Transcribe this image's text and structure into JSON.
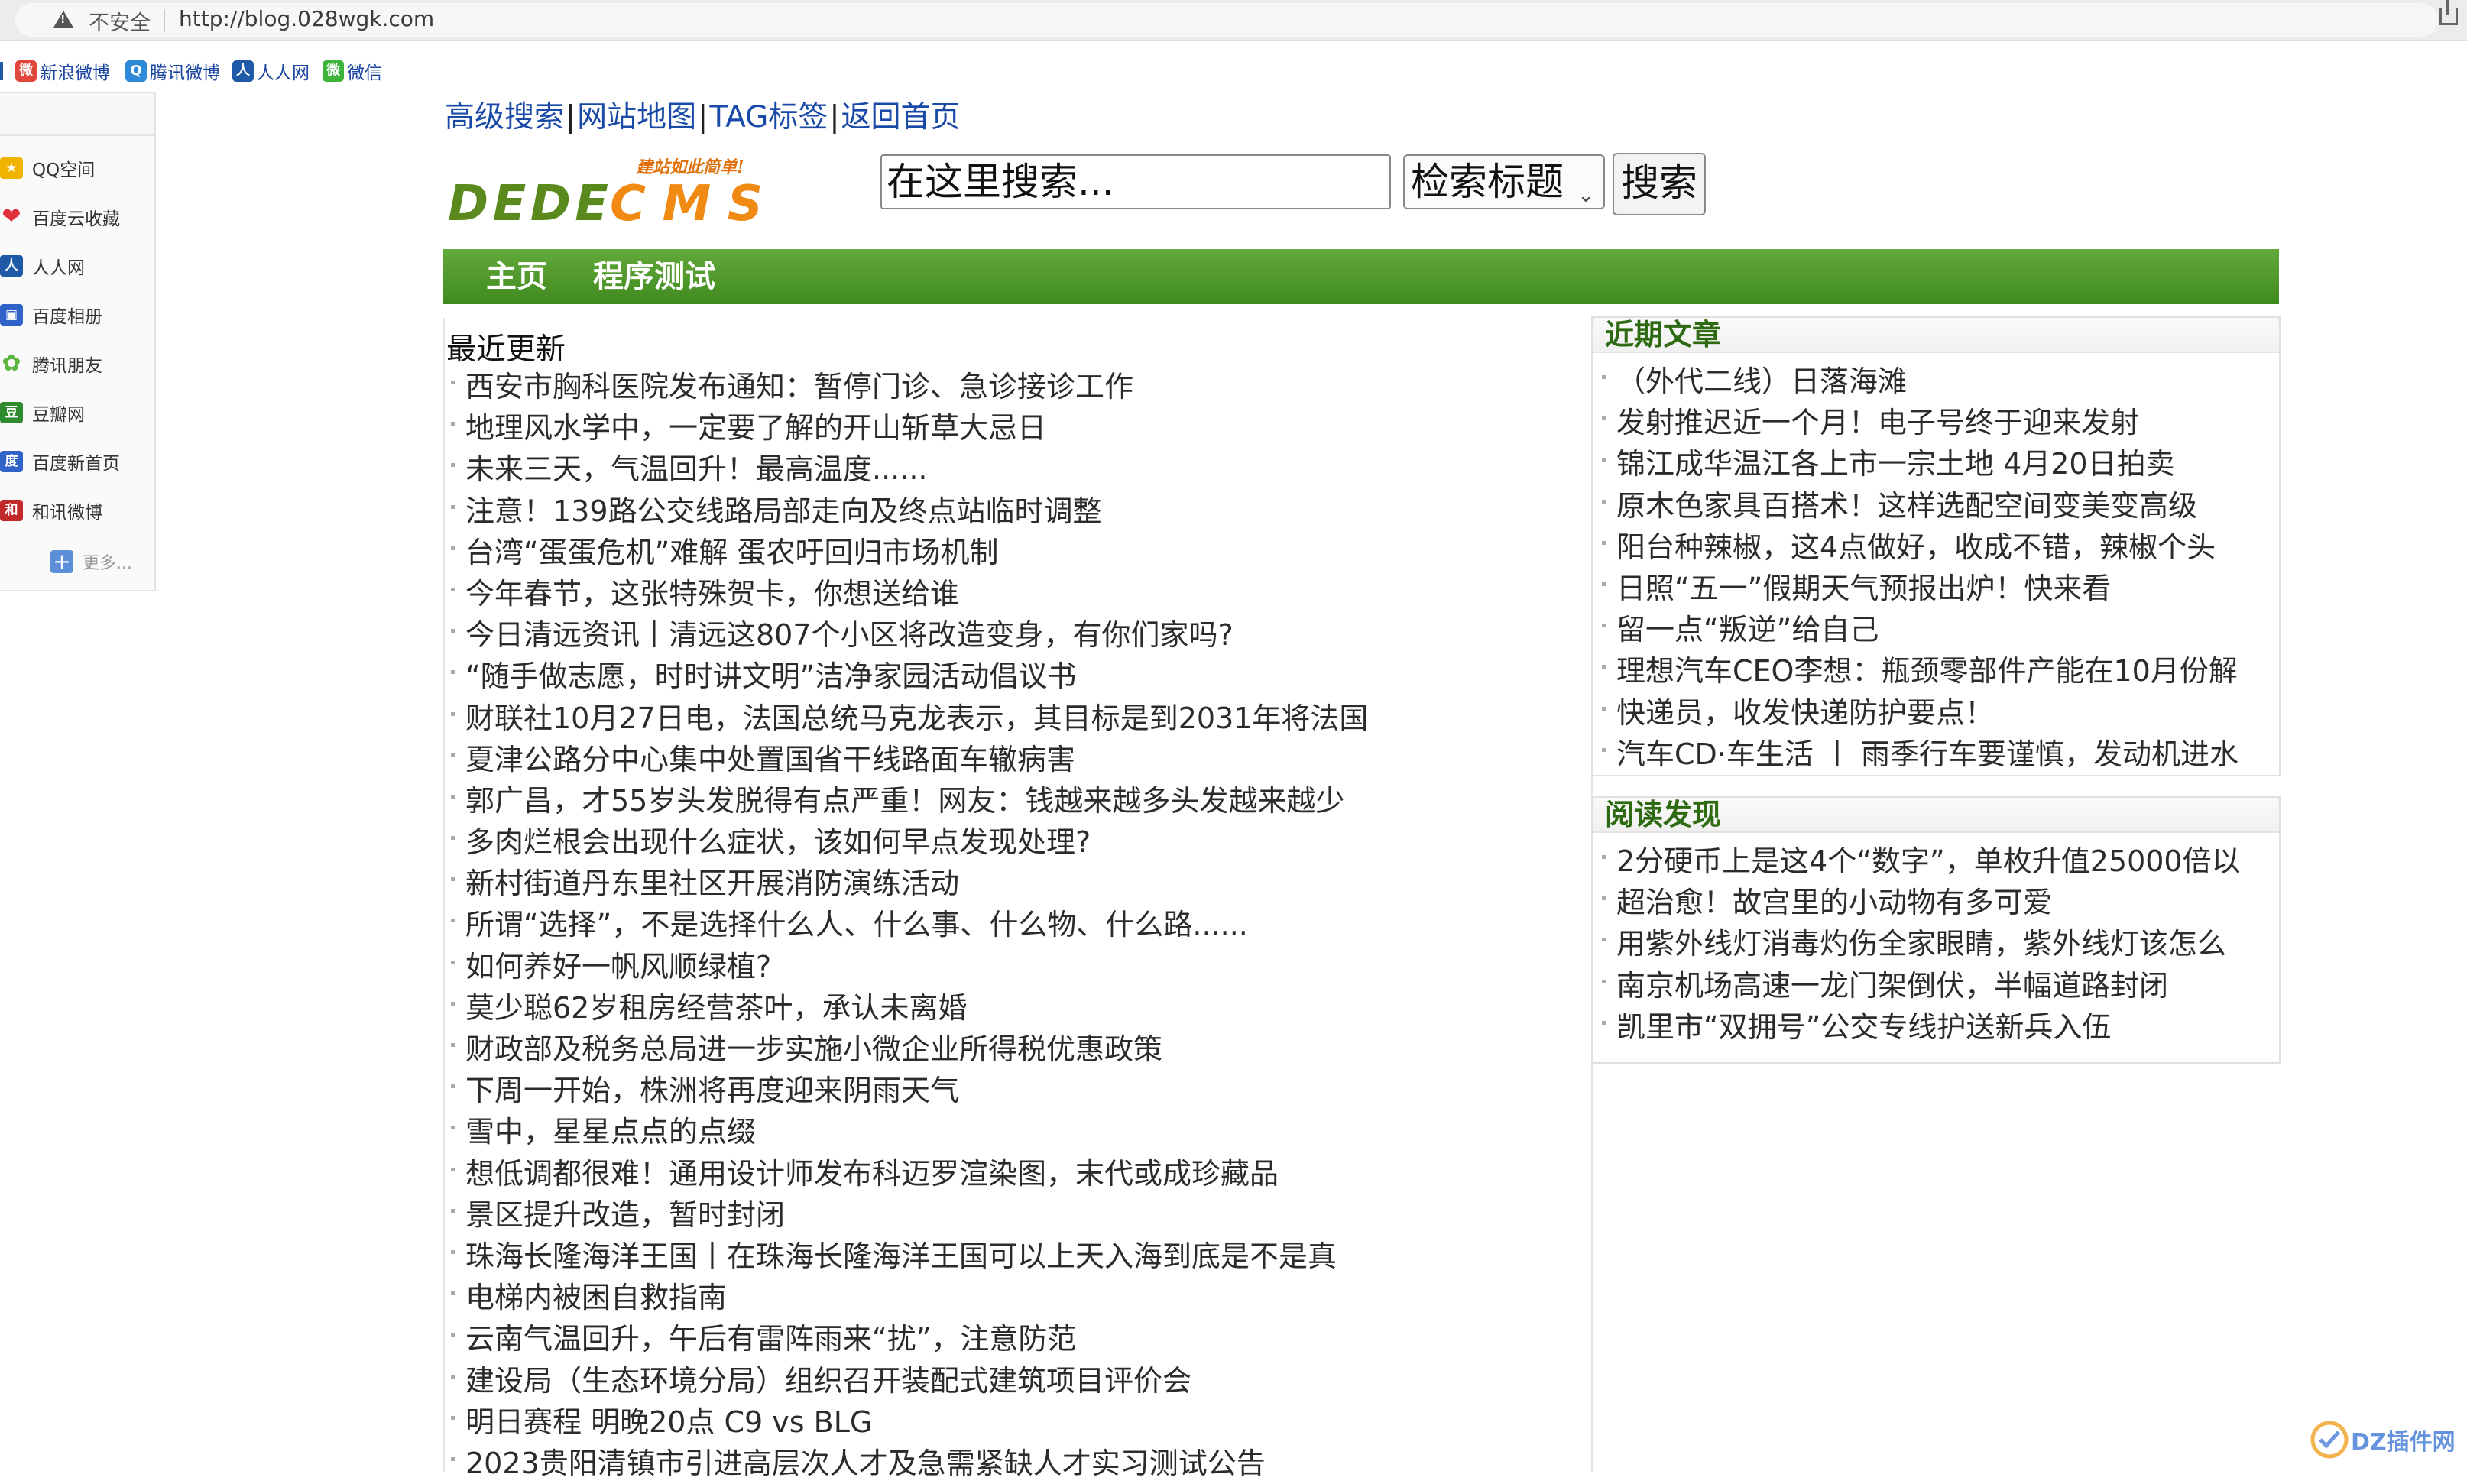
{
  "browser": {
    "security_label": "不安全",
    "url": "http://blog.028wgk.com"
  },
  "bookmarks": [
    {
      "label": "新浪微博",
      "icon": "sina-weibo-icon",
      "color": "#e0463a"
    },
    {
      "label": "腾讯微博",
      "icon": "tencent-weibo-icon",
      "color": "#2d8ad8"
    },
    {
      "label": "人人网",
      "icon": "renren-icon",
      "color": "#1f5aa8"
    },
    {
      "label": "微信",
      "icon": "wechat-icon",
      "color": "#3db33a"
    }
  ],
  "share_panel": {
    "items": [
      {
        "label": "QQ空间",
        "icon": "qzone-icon",
        "color": "#f0b400"
      },
      {
        "label": "百度云收藏",
        "icon": "heart-icon",
        "color": "#e0323a"
      },
      {
        "label": "人人网",
        "icon": "renren-icon",
        "color": "#1f5aa8"
      },
      {
        "label": "百度相册",
        "icon": "baidu-album-icon",
        "color": "#2f63c8"
      },
      {
        "label": "腾讯朋友",
        "icon": "tencent-friend-icon",
        "color": "#5cb540"
      },
      {
        "label": "豆瓣网",
        "icon": "douban-icon",
        "color": "#2e8b2e"
      },
      {
        "label": "百度新首页",
        "icon": "baidu-icon",
        "color": "#2f63c8"
      },
      {
        "label": "和讯微博",
        "icon": "hexun-icon",
        "color": "#c0282a"
      }
    ],
    "more_label": "更多..."
  },
  "top_links": [
    "高级搜索",
    "网站地图",
    "TAG标签",
    "返回首页"
  ],
  "logo": {
    "slogan": "建站如此简单!",
    "brand_left": "DEDE",
    "brand_right": "CMS"
  },
  "search": {
    "placeholder": "在这里搜索...",
    "select_value": "检索标题",
    "button": "搜索"
  },
  "nav": [
    "主页",
    "程序测试"
  ],
  "latest": {
    "title": "最近更新",
    "items": [
      "西安市胸科医院发布通知：暂停门诊、急诊接诊工作",
      "地理风水学中，一定要了解的开山斩草大忌日",
      "未来三天，气温回升！最高温度......",
      "注意！139路公交线路局部走向及终点站临时调整",
      "台湾“蛋蛋危机”难解 蛋农吁回归市场机制",
      "今年春节，这张特殊贺卡，你想送给谁",
      "今日清远资讯丨清远这807个小区将改造变身，有你们家吗?",
      "“随手做志愿，时时讲文明”洁净家园活动倡议书",
      "财联社10月27日电，法国总统马克龙表示，其目标是到2031年将法国",
      "夏津公路分中心集中处置国省干线路面车辙病害",
      "郭广昌，才55岁头发脱得有点严重！网友：钱越来越多头发越来越少",
      "多肉烂根会出现什么症状，该如何早点发现处理?",
      "新村街道丹东里社区开展消防演练活动",
      "所谓“选择”，不是选择什么人、什么事、什么物、什么路......",
      "如何养好一帆风顺绿植?",
      "莫少聪62岁租房经营茶叶，承认未离婚",
      "财政部及税务总局进一步实施小微企业所得税优惠政策",
      "下周一开始，株洲将再度迎来阴雨天气",
      "雪中，星星点点的点缀",
      "想低调都很难！通用设计师发布科迈罗渲染图，末代或成珍藏品",
      "景区提升改造，暂时封闭",
      "珠海长隆海洋王国丨在珠海长隆海洋王国可以上天入海到底是不是真",
      "电梯内被困自救指南",
      "云南气温回升，午后有雷阵雨来“扰”，注意防范",
      "建设局（生态环境分局）组织召开装配式建筑项目评价会",
      "明日赛程 明晚20点 C9 vs BLG",
      "2023贵阳清镇市引进高层次人才及急需紧缺人才实习测试公告"
    ]
  },
  "recent": {
    "title": "近期文章",
    "items": [
      "（外代二线）日落海滩",
      "发射推迟近一个月！电子号终于迎来发射",
      "锦江成华温江各上市一宗土地 4月20日拍卖",
      "原木色家具百搭术！这样选配空间变美变高级",
      "阳台种辣椒，这4点做好，收成不错，辣椒个头",
      "日照“五一”假期天气预报出炉！快来看",
      "留一点“叛逆”给自己",
      "理想汽车CEO李想：瓶颈零部件产能在10月份解",
      "快递员，收发快递防护要点！",
      "汽车CD·车生活 丨 雨季行车要谨慎，发动机进水"
    ]
  },
  "discover": {
    "title": "阅读发现",
    "items": [
      "2分硬币上是这4个“数字”，单枚升值25000倍以",
      "超治愈！故宫里的小动物有多可爱",
      "用紫外线灯消毒灼伤全家眼睛，紫外线灯该怎么",
      "南京机场高速一龙门架倒伏，半幅道路封闭",
      "凯里市“双拥号”公交专线护送新兵入伍"
    ]
  },
  "watermark": {
    "text": "DZ插件网"
  },
  "colors": {
    "nav_green": "#4c9a2a",
    "heading_green": "#2e6a12",
    "link_blue": "#1a4aa8",
    "logo_green": "#5a8a1e",
    "logo_orange": "#f08a12"
  }
}
